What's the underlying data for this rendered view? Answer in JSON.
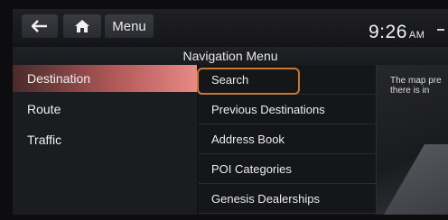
{
  "topbar": {
    "menu_label": "Menu",
    "time": "9:26",
    "ampm": "AM"
  },
  "title": "Navigation Menu",
  "left_menu": [
    {
      "label": "Destination",
      "active": true
    },
    {
      "label": "Route",
      "active": false
    },
    {
      "label": "Traffic",
      "active": false
    }
  ],
  "list": [
    {
      "label": "Search"
    },
    {
      "label": "Previous Destinations"
    },
    {
      "label": "Address Book"
    },
    {
      "label": "POI Categories"
    },
    {
      "label": "Genesis Dealerships"
    }
  ],
  "preview": {
    "line1": "The map pre",
    "line2": "there is in"
  },
  "colors": {
    "accent_highlight": "#c9762f",
    "active_item": "#e88a86"
  }
}
